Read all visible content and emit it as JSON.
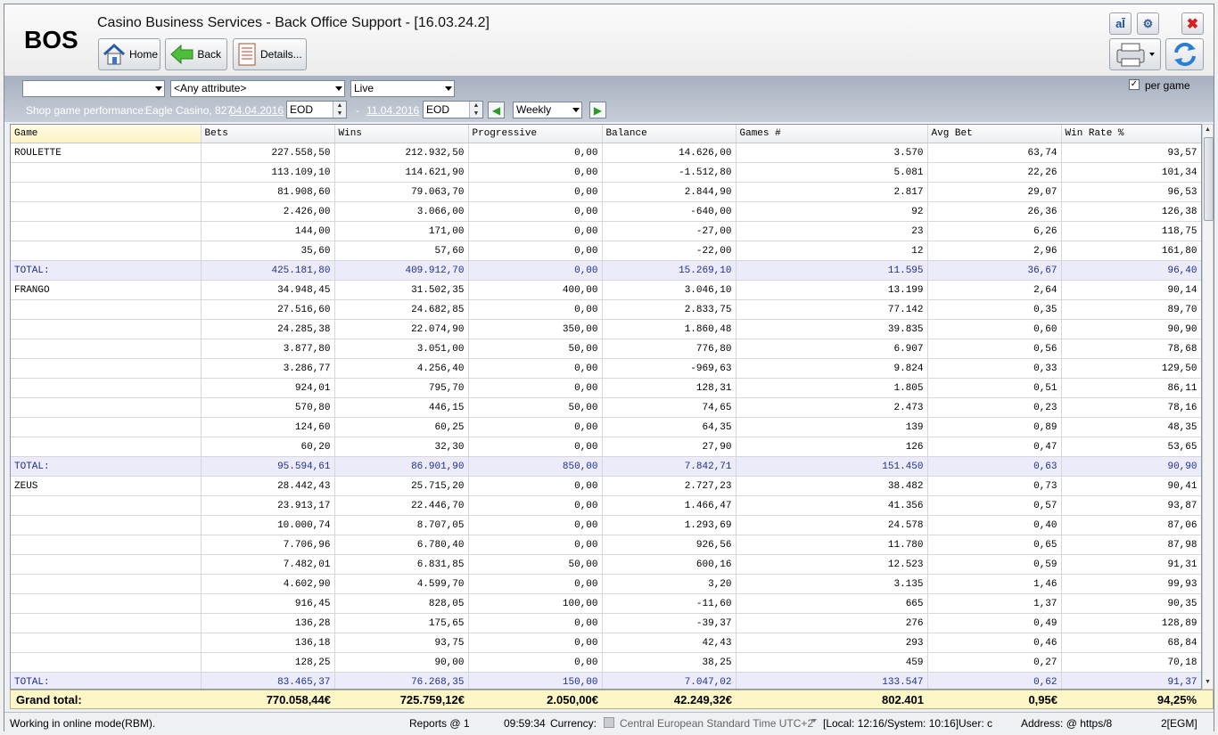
{
  "app": {
    "logo": "BOS",
    "title": "Casino Business Services - Back Office Support - [16.03.24.2]"
  },
  "toolbar": {
    "home_label": "Home",
    "back_label": "Back",
    "details_label": "Details..."
  },
  "filters": {
    "combo1": "",
    "attribute": "<Any attribute>",
    "mode": "Live",
    "report_label": "Shop game performance:",
    "casino": "Eagle Casino, 827",
    "date_from": "04.04.2016",
    "from_type": "EOD",
    "separator": "-",
    "date_to": "11.04.2016",
    "to_type": "EOD",
    "period": "Weekly",
    "per_game_label": "per game",
    "per_game_checked": true
  },
  "columns": [
    "Game",
    "Bets",
    "Wins",
    "Progressive",
    "Balance",
    "Games #",
    "Avg Bet",
    "Win Rate %"
  ],
  "rows": [
    {
      "type": "data",
      "cells": [
        "ROULETTE",
        "227.558,50",
        "212.932,50",
        "0,00",
        "14.626,00",
        "3.570",
        "63,74",
        "93,57"
      ]
    },
    {
      "type": "data",
      "cells": [
        "",
        "113.109,10",
        "114.621,90",
        "0,00",
        "-1.512,80",
        "5.081",
        "22,26",
        "101,34"
      ]
    },
    {
      "type": "data",
      "cells": [
        "",
        "81.908,60",
        "79.063,70",
        "0,00",
        "2.844,90",
        "2.817",
        "29,07",
        "96,53"
      ]
    },
    {
      "type": "data",
      "cells": [
        "",
        "2.426,00",
        "3.066,00",
        "0,00",
        "-640,00",
        "92",
        "26,36",
        "126,38"
      ]
    },
    {
      "type": "data",
      "cells": [
        "",
        "144,00",
        "171,00",
        "0,00",
        "-27,00",
        "23",
        "6,26",
        "118,75"
      ]
    },
    {
      "type": "data",
      "cells": [
        "",
        "35,60",
        "57,60",
        "0,00",
        "-22,00",
        "12",
        "2,96",
        "161,80"
      ]
    },
    {
      "type": "total",
      "cells": [
        "TOTAL:",
        "425.181,80",
        "409.912,70",
        "0,00",
        "15.269,10",
        "11.595",
        "36,67",
        "96,40"
      ]
    },
    {
      "type": "data",
      "cells": [
        "FRANGO",
        "34.948,45",
        "31.502,35",
        "400,00",
        "3.046,10",
        "13.199",
        "2,64",
        "90,14"
      ]
    },
    {
      "type": "data",
      "cells": [
        "",
        "27.516,60",
        "24.682,85",
        "0,00",
        "2.833,75",
        "77.142",
        "0,35",
        "89,70"
      ]
    },
    {
      "type": "data",
      "cells": [
        "",
        "24.285,38",
        "22.074,90",
        "350,00",
        "1.860,48",
        "39.835",
        "0,60",
        "90,90"
      ]
    },
    {
      "type": "data",
      "cells": [
        "",
        "3.877,80",
        "3.051,00",
        "50,00",
        "776,80",
        "6.907",
        "0,56",
        "78,68"
      ]
    },
    {
      "type": "data",
      "cells": [
        "",
        "3.286,77",
        "4.256,40",
        "0,00",
        "-969,63",
        "9.824",
        "0,33",
        "129,50"
      ]
    },
    {
      "type": "data",
      "cells": [
        "",
        "924,01",
        "795,70",
        "0,00",
        "128,31",
        "1.805",
        "0,51",
        "86,11"
      ]
    },
    {
      "type": "data",
      "cells": [
        "",
        "570,80",
        "446,15",
        "50,00",
        "74,65",
        "2.473",
        "0,23",
        "78,16"
      ]
    },
    {
      "type": "data",
      "cells": [
        "",
        "124,60",
        "60,25",
        "0,00",
        "64,35",
        "139",
        "0,89",
        "48,35"
      ]
    },
    {
      "type": "data",
      "cells": [
        "",
        "60,20",
        "32,30",
        "0,00",
        "27,90",
        "126",
        "0,47",
        "53,65"
      ]
    },
    {
      "type": "total",
      "cells": [
        "TOTAL:",
        "95.594,61",
        "86.901,90",
        "850,00",
        "7.842,71",
        "151.450",
        "0,63",
        "90,90"
      ]
    },
    {
      "type": "data",
      "cells": [
        "ZEUS",
        "28.442,43",
        "25.715,20",
        "0,00",
        "2.727,23",
        "38.482",
        "0,73",
        "90,41"
      ]
    },
    {
      "type": "data",
      "cells": [
        "",
        "23.913,17",
        "22.446,70",
        "0,00",
        "1.466,47",
        "41.356",
        "0,57",
        "93,87"
      ]
    },
    {
      "type": "data",
      "cells": [
        "",
        "10.000,74",
        "8.707,05",
        "0,00",
        "1.293,69",
        "24.578",
        "0,40",
        "87,06"
      ]
    },
    {
      "type": "data",
      "cells": [
        "",
        "7.706,96",
        "6.780,40",
        "0,00",
        "926,56",
        "11.780",
        "0,65",
        "87,98"
      ]
    },
    {
      "type": "data",
      "cells": [
        "",
        "7.482,01",
        "6.831,85",
        "50,00",
        "600,16",
        "12.523",
        "0,59",
        "91,31"
      ]
    },
    {
      "type": "data",
      "cells": [
        "",
        "4.602,90",
        "4.599,70",
        "0,00",
        "3,20",
        "3.135",
        "1,46",
        "99,93"
      ]
    },
    {
      "type": "data",
      "cells": [
        "",
        "916,45",
        "828,05",
        "100,00",
        "-11,60",
        "665",
        "1,37",
        "90,35"
      ]
    },
    {
      "type": "data",
      "cells": [
        "",
        "136,28",
        "175,65",
        "0,00",
        "-39,37",
        "276",
        "0,49",
        "128,89"
      ]
    },
    {
      "type": "data",
      "cells": [
        "",
        "136,18",
        "93,75",
        "0,00",
        "42,43",
        "293",
        "0,46",
        "68,84"
      ]
    },
    {
      "type": "data",
      "cells": [
        "",
        "128,25",
        "90,00",
        "0,00",
        "38,25",
        "459",
        "0,27",
        "70,18"
      ]
    },
    {
      "type": "total",
      "cells": [
        "TOTAL:",
        "83.465,37",
        "76.268,35",
        "150,00",
        "7.047,02",
        "133.547",
        "0,62",
        "91,37"
      ]
    }
  ],
  "grand_total": {
    "label": "Grand total:",
    "bets": "770.058,44€",
    "wins": "725.759,12€",
    "progressive": "2.050,00€",
    "balance": "42.249,32€",
    "games": "802.401",
    "avg_bet": "0,95€",
    "win_rate": "94,25%"
  },
  "status": {
    "mode": "Working in online mode(RBM).",
    "reports": "Reports @ 1",
    "time": "09:59:34",
    "currency_label": "Currency:",
    "timezone": "Central European Standard Time UTC+2",
    "local_system": "[Local: 12:16/System: 10:16]",
    "user_label": "User: c",
    "address": "Address: @ https/8",
    "egm": "2[EGM]"
  },
  "colors": {
    "accent": "#2b9a2b",
    "total_row": "#ebebfa",
    "total_text": "#1f2f8c",
    "grand_total_bg": "#fdf6c6",
    "filter_bar": "#b2bac7"
  }
}
